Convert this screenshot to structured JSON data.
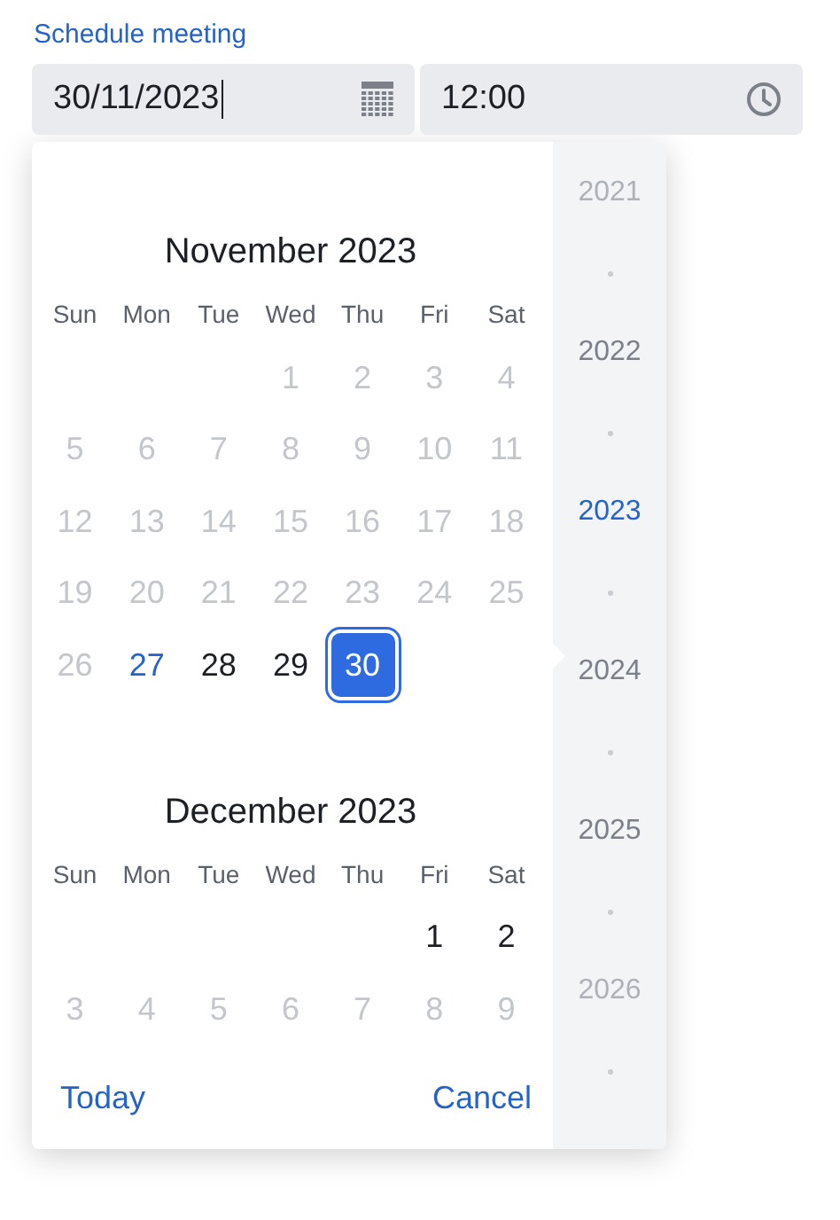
{
  "label": "Schedule meeting",
  "date_field": {
    "value": "30/11/2023",
    "focused": true
  },
  "time_field": {
    "value": "12:00"
  },
  "months": [
    {
      "title": "November 2023",
      "weekdays": [
        "Sun",
        "Mon",
        "Tue",
        "Wed",
        "Thu",
        "Fri",
        "Sat"
      ],
      "weeks": [
        [
          {
            "kind": "blank"
          },
          {
            "kind": "blank"
          },
          {
            "kind": "blank"
          },
          {
            "kind": "day",
            "day": "1",
            "disabled": true,
            "today": false,
            "selected": false
          },
          {
            "kind": "day",
            "day": "2",
            "disabled": true,
            "today": false,
            "selected": false
          },
          {
            "kind": "day",
            "day": "3",
            "disabled": true,
            "today": false,
            "selected": false
          },
          {
            "kind": "day",
            "day": "4",
            "disabled": true,
            "today": false,
            "selected": false
          }
        ],
        [
          {
            "kind": "day",
            "day": "5",
            "disabled": true,
            "today": false,
            "selected": false
          },
          {
            "kind": "day",
            "day": "6",
            "disabled": true,
            "today": false,
            "selected": false
          },
          {
            "kind": "day",
            "day": "7",
            "disabled": true,
            "today": false,
            "selected": false
          },
          {
            "kind": "day",
            "day": "8",
            "disabled": true,
            "today": false,
            "selected": false
          },
          {
            "kind": "day",
            "day": "9",
            "disabled": true,
            "today": false,
            "selected": false
          },
          {
            "kind": "day",
            "day": "10",
            "disabled": true,
            "today": false,
            "selected": false
          },
          {
            "kind": "day",
            "day": "11",
            "disabled": true,
            "today": false,
            "selected": false
          }
        ],
        [
          {
            "kind": "day",
            "day": "12",
            "disabled": true,
            "today": false,
            "selected": false
          },
          {
            "kind": "day",
            "day": "13",
            "disabled": true,
            "today": false,
            "selected": false
          },
          {
            "kind": "day",
            "day": "14",
            "disabled": true,
            "today": false,
            "selected": false
          },
          {
            "kind": "day",
            "day": "15",
            "disabled": true,
            "today": false,
            "selected": false
          },
          {
            "kind": "day",
            "day": "16",
            "disabled": true,
            "today": false,
            "selected": false
          },
          {
            "kind": "day",
            "day": "17",
            "disabled": true,
            "today": false,
            "selected": false
          },
          {
            "kind": "day",
            "day": "18",
            "disabled": true,
            "today": false,
            "selected": false
          }
        ],
        [
          {
            "kind": "day",
            "day": "19",
            "disabled": true,
            "today": false,
            "selected": false
          },
          {
            "kind": "day",
            "day": "20",
            "disabled": true,
            "today": false,
            "selected": false
          },
          {
            "kind": "day",
            "day": "21",
            "disabled": true,
            "today": false,
            "selected": false
          },
          {
            "kind": "day",
            "day": "22",
            "disabled": true,
            "today": false,
            "selected": false
          },
          {
            "kind": "day",
            "day": "23",
            "disabled": true,
            "today": false,
            "selected": false
          },
          {
            "kind": "day",
            "day": "24",
            "disabled": true,
            "today": false,
            "selected": false
          },
          {
            "kind": "day",
            "day": "25",
            "disabled": true,
            "today": false,
            "selected": false
          }
        ],
        [
          {
            "kind": "day",
            "day": "26",
            "disabled": true,
            "today": false,
            "selected": false
          },
          {
            "kind": "day",
            "day": "27",
            "disabled": false,
            "today": true,
            "selected": false
          },
          {
            "kind": "day",
            "day": "28",
            "disabled": false,
            "today": false,
            "selected": false
          },
          {
            "kind": "day",
            "day": "29",
            "disabled": false,
            "today": false,
            "selected": false
          },
          {
            "kind": "day",
            "day": "30",
            "disabled": false,
            "today": false,
            "selected": true
          },
          {
            "kind": "blank"
          },
          {
            "kind": "blank"
          }
        ]
      ]
    },
    {
      "title": "December 2023",
      "weekdays": [
        "Sun",
        "Mon",
        "Tue",
        "Wed",
        "Thu",
        "Fri",
        "Sat"
      ],
      "weeks": [
        [
          {
            "kind": "blank"
          },
          {
            "kind": "blank"
          },
          {
            "kind": "blank"
          },
          {
            "kind": "blank"
          },
          {
            "kind": "blank"
          },
          {
            "kind": "day",
            "day": "1",
            "disabled": false,
            "today": false,
            "selected": false
          },
          {
            "kind": "day",
            "day": "2",
            "disabled": false,
            "today": false,
            "selected": false
          }
        ],
        [
          {
            "kind": "day",
            "day": "3",
            "disabled": true,
            "today": false,
            "selected": false
          },
          {
            "kind": "day",
            "day": "4",
            "disabled": true,
            "today": false,
            "selected": false
          },
          {
            "kind": "day",
            "day": "5",
            "disabled": true,
            "today": false,
            "selected": false
          },
          {
            "kind": "day",
            "day": "6",
            "disabled": true,
            "today": false,
            "selected": false
          },
          {
            "kind": "day",
            "day": "7",
            "disabled": true,
            "today": false,
            "selected": false
          },
          {
            "kind": "day",
            "day": "8",
            "disabled": true,
            "today": false,
            "selected": false
          },
          {
            "kind": "day",
            "day": "9",
            "disabled": true,
            "today": false,
            "selected": false
          }
        ]
      ]
    }
  ],
  "years": [
    {
      "label": "2021",
      "selected": false,
      "faded": true
    },
    {
      "label": "2022",
      "selected": false,
      "faded": false
    },
    {
      "label": "2023",
      "selected": true,
      "faded": false
    },
    {
      "label": "2024",
      "selected": false,
      "faded": false
    },
    {
      "label": "2025",
      "selected": false,
      "faded": false
    },
    {
      "label": "2026",
      "selected": false,
      "faded": true
    }
  ],
  "buttons": [
    "Today",
    "Cancel"
  ]
}
